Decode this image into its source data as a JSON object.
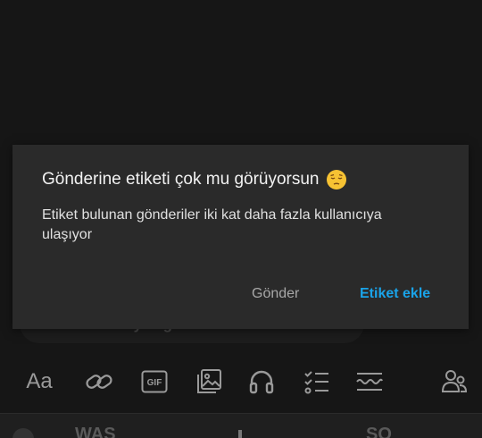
{
  "background_hint": "# Etiket de koy ki gönderin bulunabilsin",
  "dialog": {
    "title": "Gönderine etiketi çok mu görüyorsun",
    "emoji": "pensive-face",
    "body": "Etiket bulunan gönderiler iki kat daha fazla kullanıcıya ulaşıyor",
    "send_label": "Gönder",
    "add_tag_label": "Etiket ekle"
  },
  "toolbar": {
    "text_format_label": "Aa",
    "gif_label": "GIF",
    "icons": [
      "text-format-icon",
      "link-icon",
      "gif-icon",
      "image-icon",
      "headphones-icon",
      "checklist-icon",
      "wave-icon",
      "people-icon"
    ]
  },
  "bottom_bar": {
    "left_text": "WAS",
    "right_text": "SO"
  },
  "colors": {
    "background": "#161616",
    "dialog": "#2a2a2a",
    "accent": "#1aa3e8",
    "muted": "#a8a8a8"
  }
}
